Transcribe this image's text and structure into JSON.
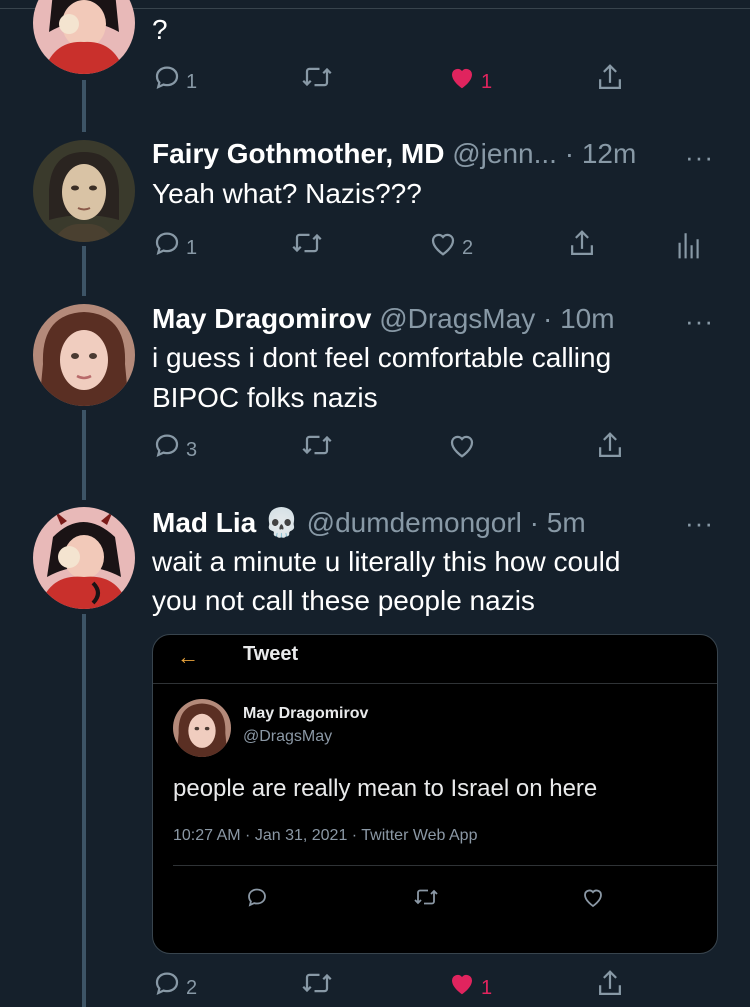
{
  "tweets": [
    {
      "text": "?",
      "actions": {
        "replies": "1",
        "retweets": "",
        "likes": "1",
        "liked": true
      }
    },
    {
      "name": "Fairy Gothmother, MD",
      "handle_time": "@jenn... · 12m",
      "text": "Yeah what? Nazis???",
      "actions": {
        "replies": "1",
        "retweets": "",
        "likes": "2",
        "liked": false
      }
    },
    {
      "name": "May Dragomirov",
      "handle_time": "@DragsMay · 10m",
      "text_lines": [
        "i guess i dont feel comfortable calling",
        "BIPOC folks nazis"
      ],
      "actions": {
        "replies": "3",
        "retweets": "",
        "likes": "",
        "liked": false
      }
    },
    {
      "name": "Mad Lia",
      "name_emoji": "💀",
      "handle_time": "@dumdemongorl · 5m",
      "text_lines": [
        "wait a minute u literally this how could",
        "you not call these people nazis"
      ],
      "actions": {
        "replies": "2",
        "retweets": "",
        "likes": "1",
        "liked": true
      }
    }
  ],
  "more_label": "···",
  "embedded": {
    "back_arrow": "←",
    "header_title": "Tweet",
    "name": "May Dragomirov",
    "handle": "@DragsMay",
    "text": "people are really mean to Israel on here",
    "meta": "10:27 AM · Jan 31, 2021 · Twitter Web App"
  },
  "colors": {
    "background": "#15202b",
    "secondary_text": "#8899a6",
    "like_red": "#e0245e",
    "thread_line": "#3d5466"
  },
  "icons": [
    "reply-icon",
    "retweet-icon",
    "like-icon",
    "share-icon",
    "analytics-icon",
    "more-icon",
    "skull-emoji"
  ]
}
